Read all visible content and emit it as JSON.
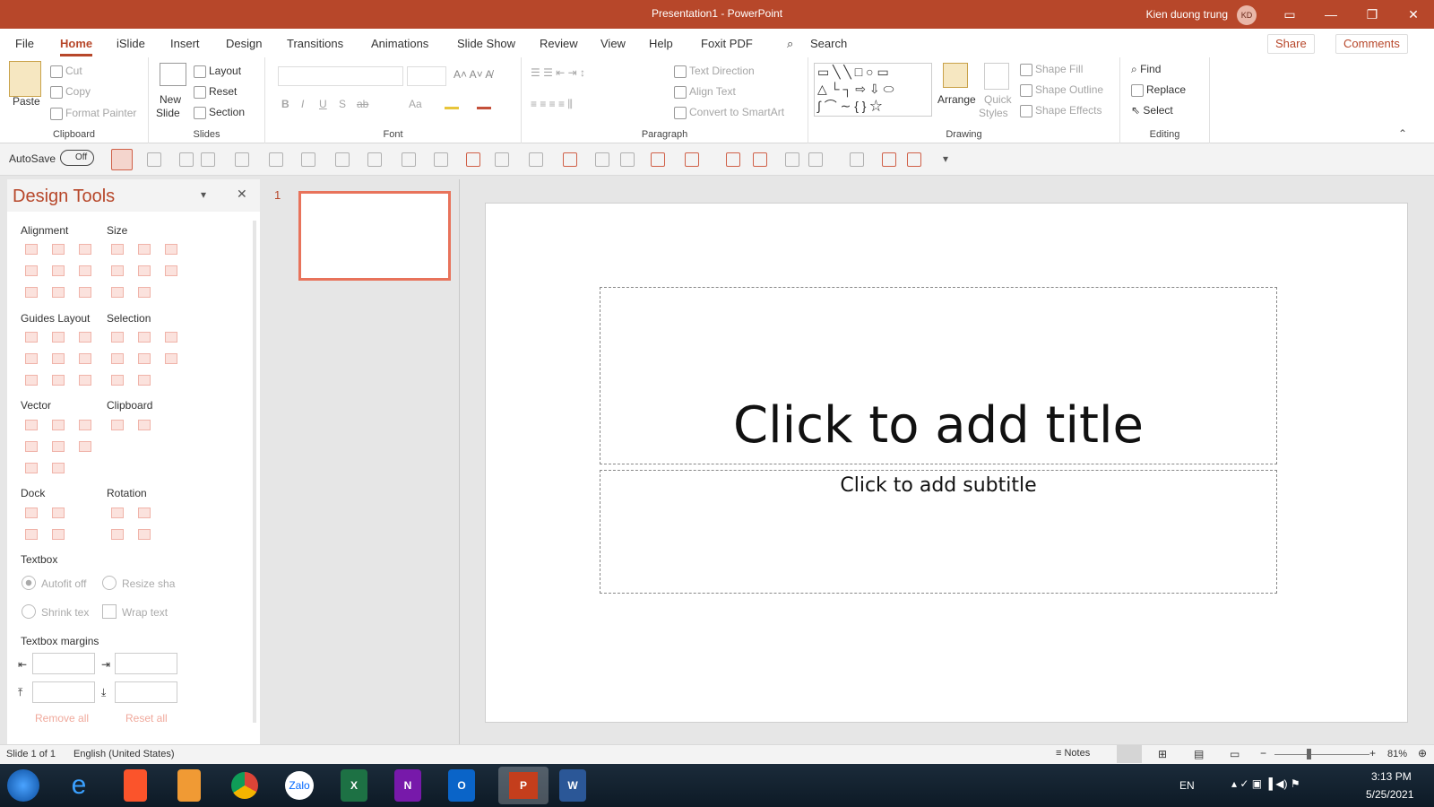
{
  "window": {
    "title": "Presentation1  -  PowerPoint",
    "user": "Kien duong trung",
    "avatar": "KD"
  },
  "tabs": [
    "File",
    "Home",
    "iSlide",
    "Insert",
    "Design",
    "Transitions",
    "Animations",
    "Slide Show",
    "Review",
    "View",
    "Help",
    "Foxit PDF"
  ],
  "search": "Search",
  "share": "Share",
  "comments": "Comments",
  "ribbon": {
    "clipboard": {
      "paste": "Paste",
      "cut": "Cut",
      "copy": "Copy",
      "format_painter": "Format Painter",
      "label": "Clipboard"
    },
    "slides": {
      "new_slide_1": "New",
      "new_slide_2": "Slide",
      "layout": "Layout",
      "reset": "Reset",
      "section": "Section",
      "label": "Slides"
    },
    "font": {
      "bold": "B",
      "italic": "I",
      "underline": "U",
      "shadow": "S",
      "strike": "ab",
      "case": "Aa",
      "label": "Font"
    },
    "paragraph": {
      "text_direction": "Text Direction",
      "align_text": "Align Text",
      "smartart": "Convert to SmartArt",
      "label": "Paragraph"
    },
    "drawing": {
      "arrange": "Arrange",
      "quick_styles_1": "Quick",
      "quick_styles_2": "Styles",
      "shape_fill": "Shape Fill",
      "shape_outline": "Shape Outline",
      "shape_effects": "Shape Effects",
      "label": "Drawing"
    },
    "editing": {
      "find": "Find",
      "replace": "Replace",
      "select": "Select",
      "label": "Editing"
    }
  },
  "autosave": {
    "label": "AutoSave",
    "state": "Off"
  },
  "design_tools": {
    "title": "Design Tools",
    "sections": {
      "alignment": "Alignment",
      "size": "Size",
      "guides_layout": "Guides Layout",
      "selection": "Selection",
      "vector": "Vector",
      "clipboard": "Clipboard",
      "dock": "Dock",
      "rotation": "Rotation",
      "textbox": "Textbox",
      "textbox_margins": "Textbox margins"
    },
    "textbox_options": {
      "autofit_off": "Autofit off",
      "resize_shape": "Resize sha",
      "shrink_text": "Shrink tex",
      "wrap_text": "Wrap text"
    },
    "remove_all": "Remove all",
    "reset_all": "Reset all"
  },
  "thumbnail_number": "1",
  "slide": {
    "title_placeholder": "Click to add title",
    "subtitle_placeholder": "Click to add subtitle"
  },
  "status": {
    "slide": "Slide 1 of 1",
    "language": "English (United States)",
    "notes": "Notes",
    "zoom": "81%"
  },
  "taskbar": {
    "lang": "EN",
    "time": "3:13 PM",
    "date": "5/25/2021",
    "zalo": "Zalo"
  },
  "colors": {
    "accent": "#b7472a",
    "selection": "#e8735b"
  }
}
